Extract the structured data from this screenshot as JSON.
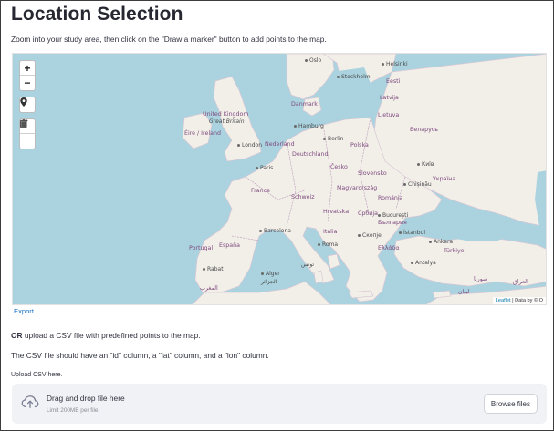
{
  "page": {
    "title": "Location Selection",
    "intro": "Zoom into your study area, then click on the \"Draw a marker\" button to add points to the map."
  },
  "map": {
    "controls": {
      "zoom_in": "+",
      "zoom_out": "−"
    },
    "labels": {
      "oslo": "Oslo",
      "helsinki": "Helsinki",
      "stockholm": "Stockholm",
      "eesti": "Eesti",
      "latvija": "Latvija",
      "danmark": "Danmark",
      "lietuva": "Lietuva",
      "united_kingdom": "United Kingdom",
      "great_britain": "Great Britain",
      "eire": "Éire / Ireland",
      "hamburg": "Hamburg",
      "belarus": "Беларусь",
      "berlin": "Berlin",
      "nederland": "Nederland",
      "london": "London",
      "polska": "Polska",
      "deutschland": "Deutschland",
      "paris": "Paris",
      "cesko": "Česko",
      "kyiv": "Київ",
      "ukraina": "Україна",
      "slovensko": "Slovensko",
      "france": "France",
      "chisinau": "Chișinău",
      "magyarorszag": "Magyarország",
      "schweiz": "Schweiz",
      "romania": "România",
      "hrvatska": "Hrvatska",
      "srbija": "Србија",
      "bucuresti": "București",
      "barcelona": "Barcelona",
      "italia": "Italia",
      "bulgaria": "България",
      "portugal": "Portugal",
      "espana": "España",
      "roma": "Roma",
      "skopje": "Скопје",
      "istanbul": "İstanbul",
      "ellada": "Ελλάδα",
      "turkiye": "Türkiye",
      "ankara": "Ankara",
      "antalya": "Antalya",
      "rabat": "Rabat",
      "algier": "Alger",
      "algier_ar": "الجزائر",
      "maroc": "المغرب",
      "tunis": "تونس",
      "syria": "سوريا",
      "iraq": "العراق",
      "lebanon": "لبنان"
    },
    "attribution_link": "Leaflet",
    "attribution_text": " | Data by © O"
  },
  "export_label": "Export",
  "upload": {
    "or_text": "OR",
    "line": " upload a CSV file with predefined points to the map.",
    "csv_note": "The CSV file should have an \"id\" column, a \"lat\" column, and a \"lon\" column.",
    "label": "Upload CSV here.",
    "drop_title": "Drag and drop file here",
    "drop_sub": "Limit 200MB per file",
    "browse": "Browse files"
  }
}
